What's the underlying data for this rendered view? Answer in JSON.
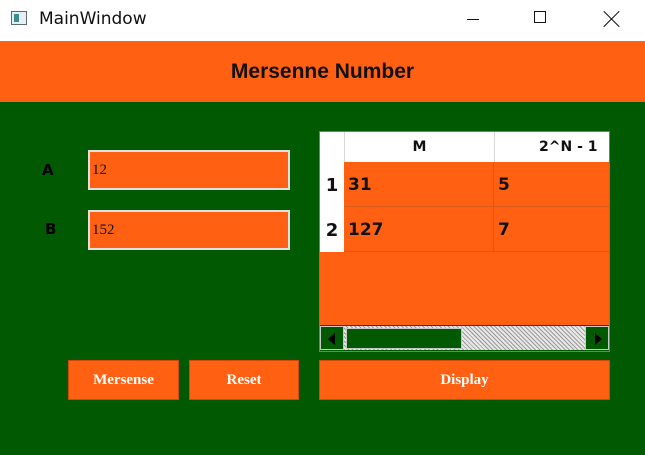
{
  "window": {
    "title": "MainWindow"
  },
  "header": {
    "title": "Mersenne Number"
  },
  "inputs": [
    {
      "label": "A",
      "value": "12"
    },
    {
      "label": "B",
      "value": "152"
    }
  ],
  "table": {
    "columns": [
      "M",
      "2^N - 1"
    ],
    "rows": [
      {
        "index": "1",
        "cells": [
          "31",
          "5"
        ]
      },
      {
        "index": "2",
        "cells": [
          "127",
          "7"
        ]
      }
    ]
  },
  "buttons": {
    "mersense": "Mersense",
    "reset": "Reset",
    "display": "Display"
  },
  "colors": {
    "accent": "#ff6012",
    "background": "#015a01",
    "titlebar": "#ffffff"
  },
  "icons": {
    "app": "app-window-icon",
    "minimize": "minimize-icon",
    "maximize": "maximize-icon",
    "close": "close-icon",
    "scroll_left": "arrow-left-icon",
    "scroll_right": "arrow-right-icon"
  }
}
